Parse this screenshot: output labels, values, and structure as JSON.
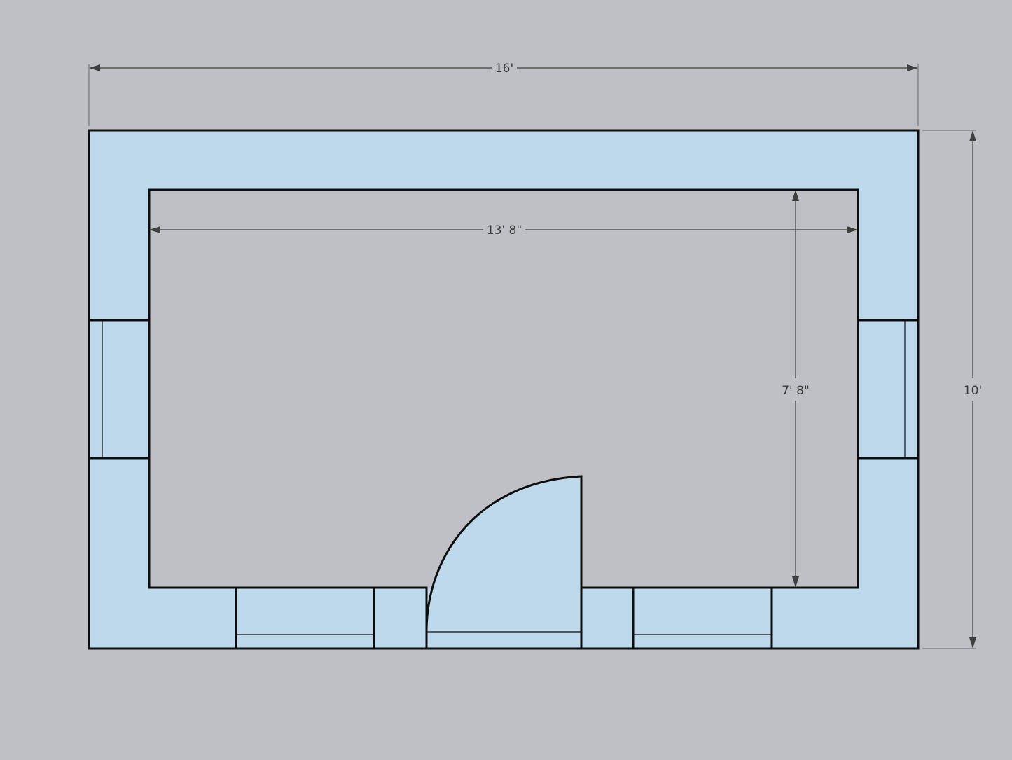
{
  "colors": {
    "background": "#bfc0c5",
    "wall_fill": "#bed9ec",
    "line": "#0d0d0d",
    "dimension": "#3f3f3f"
  },
  "dimensions": {
    "outer_width": "16'",
    "inner_width": "13' 8\"",
    "inner_height": "7' 8\"",
    "outer_height": "10'"
  }
}
